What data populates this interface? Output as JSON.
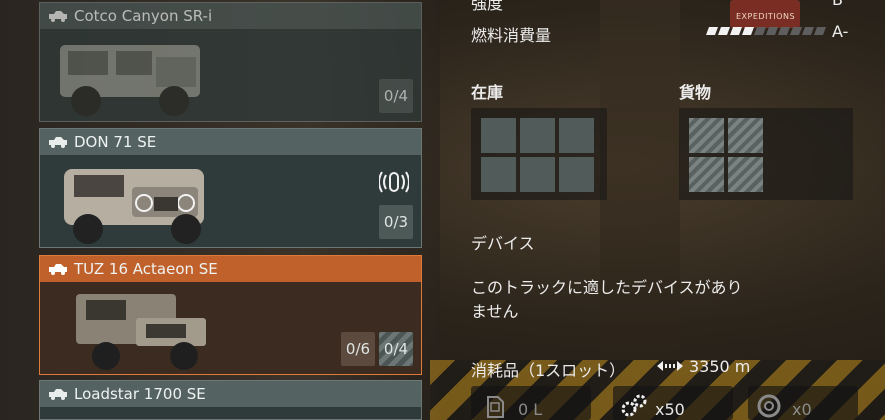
{
  "vehicles": [
    {
      "name": "Cotco Canyon SR-i",
      "slots": [
        "0/4"
      ],
      "state": "dim"
    },
    {
      "name": "DON 71 SE",
      "slots": [
        "0/3"
      ],
      "state": "normal"
    },
    {
      "name": "TUZ 16 Actaeon SE",
      "slots": [
        "0/6",
        "0/4"
      ],
      "state": "selected"
    },
    {
      "name": "Loadstar 1700 SE",
      "slots": [],
      "state": "normal"
    }
  ],
  "stats": {
    "top_label_partial": "強度",
    "top_value_partial": "B",
    "fuel_label": "燃料消費量",
    "fuel_grade": "A-",
    "fuel_rating_fraction": 0.4
  },
  "inventory": {
    "title": "在庫",
    "cells": 6
  },
  "cargo": {
    "title": "貨物",
    "cells": 4
  },
  "devices": {
    "title": "デバイス",
    "message_line1": "このトラックに適したデバイスがあり",
    "message_line2": "ません"
  },
  "consumables": {
    "title": "消耗品（1スロット）",
    "range": "3350 m",
    "items": [
      {
        "icon": "fuel-can-icon",
        "value": "0 L"
      },
      {
        "icon": "repair-parts-icon",
        "value": "x50"
      },
      {
        "icon": "wheel-icon",
        "value": "x0"
      }
    ]
  },
  "background_sign": "EXPEDITIONS",
  "colors": {
    "accent": "#c0602a",
    "card_header": "#546361"
  }
}
